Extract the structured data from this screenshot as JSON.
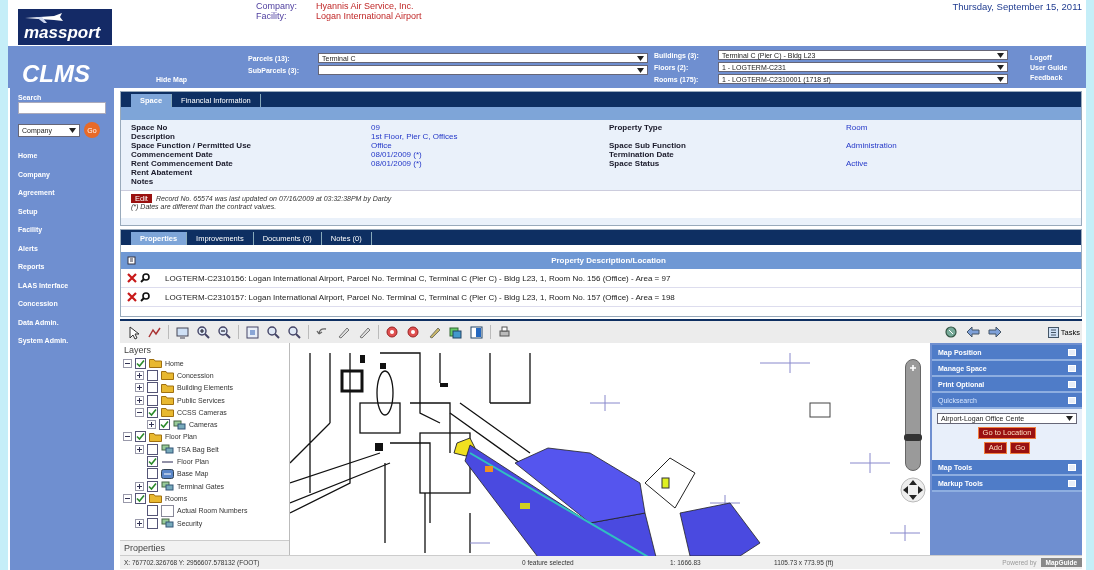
{
  "header": {
    "logo": "massport",
    "app_name": "CLMS",
    "company_label": "Company:",
    "company": "Hyannis Air Service, Inc.",
    "facility_label": "Facility:",
    "facility": "Logan International Airport",
    "date": "Thursday, September 15, 2011",
    "hide_map": "Hide Map",
    "parcel_selectors": [
      {
        "label": "Parcels (13):",
        "value": "Terminal C"
      },
      {
        "label": "SubParcels (3):"
      }
    ],
    "building_selectors": [
      {
        "label": "Buildings (3):",
        "value": "Terminal C (Pier C) - Bldg L23"
      },
      {
        "label": "Floors (2):",
        "value": "1 - LOGTERM-C231"
      },
      {
        "label": "Rooms (175):",
        "value": "1 - LOGTERM-C2310001 (1718 sf)"
      }
    ],
    "links": [
      "Logoff",
      "User Guide",
      "Feedback"
    ]
  },
  "sidebar": {
    "search_label": "Search",
    "search_scope": "Company",
    "go": "Go",
    "items": [
      "Home",
      "Company",
      "Agreement",
      "Setup",
      "Facility",
      "Alerts",
      "Reports",
      "LAAS Interface",
      "Concession",
      "Data Admin.",
      "System Admin."
    ]
  },
  "space": {
    "tabs": [
      {
        "label": "Space",
        "selected": true
      },
      {
        "label": "Financial Information",
        "selected": false
      }
    ],
    "rows": [
      {
        "left": {
          "label": "Space No",
          "value": "09"
        },
        "right": {
          "label": "Property Type",
          "value": "Room"
        }
      },
      {
        "left": {
          "label": "Description",
          "value": "1st Floor, Pier C, Offices"
        }
      },
      {
        "left": {
          "label": "Space Function / Permitted Use",
          "value": "Office"
        },
        "right": {
          "label": "Space Sub Function",
          "value": "Administration"
        }
      },
      {
        "left": {
          "label": "Commencement Date",
          "value": "08/01/2009 (*)"
        },
        "right": {
          "label": "Termination Date"
        }
      },
      {
        "left": {
          "label": "Rent Commencement Date",
          "value": "08/01/2009 (*)"
        },
        "right": {
          "label": "Space Status",
          "value": "Active"
        }
      },
      {
        "left": {
          "label": "Rent Abatement"
        }
      },
      {
        "left": {
          "label": "Notes"
        }
      }
    ],
    "edit": "Edit",
    "record_note": "Record No. 65574 was last updated on 07/16/2009 at 03:32:38PM by Darby",
    "dates_note": "(*) Dates are different than the contract values."
  },
  "properties": {
    "tabs": [
      {
        "label": "Properties",
        "selected": true
      },
      {
        "label": "Improvements",
        "selected": false
      },
      {
        "label": "Documents (0)",
        "selected": false
      },
      {
        "label": "Notes (0)",
        "selected": false
      }
    ],
    "column": "Property Description/Location",
    "rows": [
      "LOGTERM-C2310156: Logan International Airport, Parcel No. Terminal C, Terminal C (Pier C) - Bldg L23, 1, Room No. 156 (Office) - Area = 97",
      "LOGTERM-C2310157: Logan International Airport, Parcel No. Terminal C, Terminal C (Pier C) - Bldg L23, 1, Room No. 157 (Office) - Area = 198"
    ]
  },
  "map": {
    "layers_title": "Layers",
    "properties_title": "Properties",
    "layers": [
      {
        "label": "Home",
        "kind": "folder",
        "checked": true,
        "expanded": true,
        "children": [
          {
            "label": "Concession",
            "kind": "folder",
            "checked": false,
            "expanded": false
          },
          {
            "label": "Building Elements",
            "kind": "folder",
            "checked": false,
            "expanded": false
          },
          {
            "label": "Public Services",
            "kind": "folder",
            "checked": false,
            "expanded": false
          },
          {
            "label": "CCSS Cameras",
            "kind": "folder",
            "checked": true,
            "expanded": true,
            "children": [
              {
                "label": "Cameras",
                "kind": "layer",
                "checked": true,
                "expanded": false
              }
            ]
          }
        ]
      },
      {
        "label": "Floor Plan",
        "kind": "folder",
        "checked": true,
        "expanded": true,
        "children": [
          {
            "label": "TSA Bag Belt",
            "kind": "layer",
            "checked": false,
            "expanded": false
          },
          {
            "label": "Floor Plan",
            "kind": "line",
            "checked": true
          },
          {
            "label": "Base Map",
            "kind": "image",
            "checked": false
          },
          {
            "label": "Terminal Gates",
            "kind": "layer",
            "checked": true,
            "expanded": false
          }
        ]
      },
      {
        "label": "Rooms",
        "kind": "folder",
        "checked": true,
        "expanded": true,
        "children": [
          {
            "label": "Actual Room Numbers",
            "kind": "blank",
            "checked": false
          },
          {
            "label": "Security",
            "kind": "layer",
            "checked": false,
            "expanded": false
          }
        ]
      }
    ],
    "zoom": {
      "level": 0.3
    },
    "tasks_label": "Tasks",
    "task_panels": [
      {
        "title": "Map Position",
        "expanded": false
      },
      {
        "title": "Manage Space",
        "expanded": false
      },
      {
        "title": "Print Optional",
        "expanded": false
      },
      {
        "title": "Quicksearch",
        "expanded": true,
        "select": "Airport-Logan Office Cente",
        "buttons": [
          "Go to Location",
          "Add",
          "Go"
        ]
      },
      {
        "title": "Map Tools",
        "expanded": false
      },
      {
        "title": "Markup Tools",
        "expanded": false
      }
    ]
  },
  "status_bar": {
    "coords": "X: 767702.326768  Y: 2956607.578132 (FOOT)",
    "selection": "0 feature selected",
    "scale": "1: 1666.83",
    "extent": "1105.73 x 773.95 (ft)",
    "powered_by": "Powered by",
    "brand": "MapGuide"
  }
}
